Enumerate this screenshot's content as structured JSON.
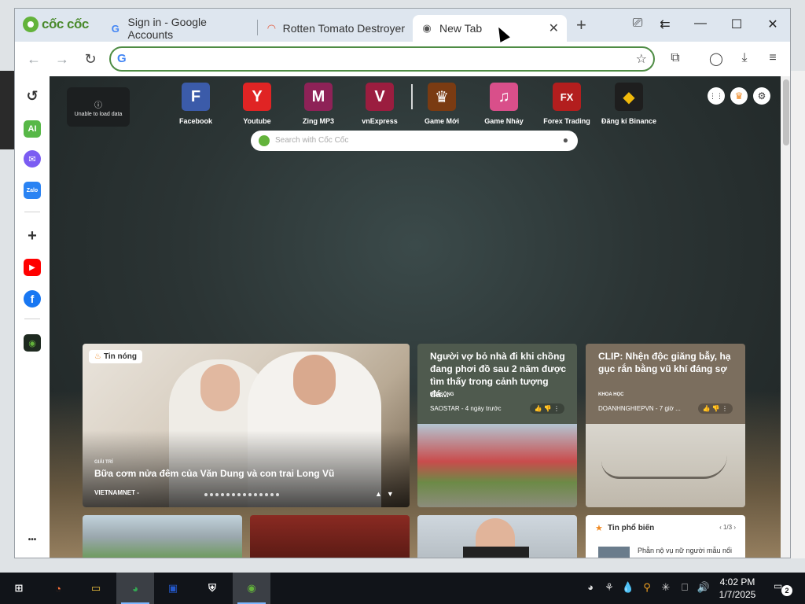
{
  "browser": {
    "brand": "cốc cốc",
    "tabs": [
      {
        "title": "Sign in - Google Accounts",
        "favicon": "google-g-icon",
        "favicon_glyph": "G",
        "favicon_color": "#4285f4"
      },
      {
        "title": "Rotten Tomato Destroyer",
        "favicon": "rainbow-icon",
        "favicon_glyph": "◠",
        "favicon_color": "#e35b3d"
      },
      {
        "title": "New Tab",
        "favicon": "coccoc-icon",
        "favicon_glyph": "◉",
        "favicon_color": "#555555",
        "active": true
      }
    ],
    "new_tab_glyph": "+",
    "close_glyph": "✕",
    "window_controls": {
      "screen_search": "⎚",
      "back_history": "⇇",
      "minimize": "—",
      "maximize": "☐",
      "close": "✕"
    },
    "omnibox": {
      "value": "",
      "placeholder": "",
      "icon": "G"
    },
    "nav": {
      "back": "←",
      "forward": "→",
      "reload": "↻"
    },
    "toolbar_icons": {
      "star": "☆",
      "extensions": "⧉",
      "account": "◯",
      "download": "⤓",
      "menu": "≡"
    }
  },
  "sidebar": {
    "items": [
      {
        "name": "history-icon",
        "glyph": "↺",
        "color": "#ffffff",
        "text_color": "#333333"
      },
      {
        "name": "ai-icon",
        "glyph": "AI",
        "color": "#57b847",
        "text_color": "#ffffff"
      },
      {
        "name": "messenger-icon",
        "glyph": "✉",
        "color": "#7b5cf2",
        "text_color": "#ffffff"
      },
      {
        "name": "zalo-icon",
        "glyph": "Zalo",
        "color": "#2a83f3",
        "text_color": "#ffffff"
      },
      {
        "name": "add-icon",
        "glyph": "+",
        "color": "#ffffff",
        "text_color": "#333333"
      },
      {
        "name": "youtube-icon",
        "glyph": "▶",
        "color": "#ff0000",
        "text_color": "#ffffff"
      },
      {
        "name": "facebook-icon",
        "glyph": "f",
        "color": "#1877f2",
        "text_color": "#ffffff"
      },
      {
        "name": "coccoc-2024-icon",
        "glyph": "◉",
        "color": "#1e2a20",
        "text_color": "#63b33b"
      },
      {
        "name": "more-icon",
        "glyph": "•••",
        "color": "#ffffff",
        "text_color": "#333333"
      }
    ]
  },
  "newtab": {
    "unable_text": "Unable to load data",
    "shortcuts": [
      {
        "label": "Facebook",
        "letter": "F",
        "color": "#3b5ba9"
      },
      {
        "label": "Youtube",
        "letter": "Y",
        "color": "#e02424"
      },
      {
        "label": "Zing MP3",
        "letter": "M",
        "color": "#8e2257"
      },
      {
        "label": "vnExpress",
        "letter": "V",
        "color": "#9b1d3f"
      },
      {
        "label": "Game Mới",
        "letter": "♛",
        "color": "#7a3b12"
      },
      {
        "label": "Game Nhảy",
        "letter": "♫",
        "color": "#d94f8a"
      },
      {
        "label": "Forex Trading",
        "letter": "FX",
        "color": "#b31e1e"
      },
      {
        "label": "Đăng kí Binance",
        "letter": "◆",
        "color": "#1e1e1e"
      }
    ],
    "top_right": {
      "apps": "⋮⋮",
      "crown": "♛",
      "settings": "⚙"
    },
    "search": {
      "placeholder": "Search with Cốc Cốc",
      "mic": "🎤"
    }
  },
  "news": {
    "featured": {
      "badge": "Tin nóng",
      "category": "GIẢI TRÍ",
      "title": "Bữa cơm nửa đêm của Văn Dung và con trai Long Vũ",
      "source": "VIETNAMNET -",
      "dot_count": 14
    },
    "cards": [
      {
        "title": "Người vợ bỏ nhà đi khi chồng đang phơi đồ sau 2 năm được tìm thấy trong cảnh tượng đá...",
        "category": "ĐỜI SỐNG",
        "source": "SAOSTAR - 4 ngày trước",
        "votes": "👍 👎 ⋮"
      },
      {
        "title": "CLIP: Nhện độc giăng bẫy, hạ gục rắn bằng vũ khí đáng sợ",
        "category": "KHOA HỌC",
        "source": "DOANHNGHIEPVN - 7 giờ ...",
        "votes": "👍 👎 ⋮"
      }
    ],
    "popular": {
      "title": "Tin phổ biến",
      "pager": "‹  1/3  ›",
      "first_item": "Phẫn nộ vụ nữ người mẫu nổi"
    }
  },
  "taskbar": {
    "apps": [
      {
        "name": "start-icon",
        "glyph": "⊞",
        "color": "#ffffff"
      },
      {
        "name": "firefox-icon",
        "glyph": "◔",
        "color": "#ff7139"
      },
      {
        "name": "file-explorer-icon",
        "glyph": "▭",
        "color": "#f0c33c"
      },
      {
        "name": "chrome-icon",
        "glyph": "◕",
        "color": "#34a853"
      },
      {
        "name": "display-icon",
        "glyph": "▣",
        "color": "#2458c9"
      },
      {
        "name": "security-icon",
        "glyph": "⛨",
        "color": "#ffffff"
      },
      {
        "name": "coccoc-taskbar-icon",
        "glyph": "◉",
        "color": "#63b33b"
      }
    ],
    "tray": [
      "◕",
      "⚘",
      "💧",
      "⚲",
      "✳",
      "⎕",
      "🔊"
    ],
    "time": "4:02 PM",
    "date": "1/7/2025",
    "notifications": "2"
  }
}
